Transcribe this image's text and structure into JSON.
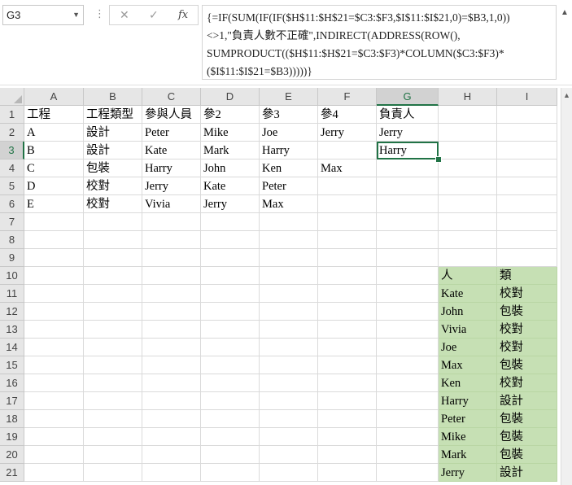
{
  "name_box": {
    "value": "G3",
    "dropdown_icon": "chevron-down-icon"
  },
  "formula_buttons": {
    "cancel": "✕",
    "enter": "✓",
    "fx": "fx"
  },
  "formula_bar": {
    "text": "{=IF(SUM(IF(IF($H$11:$H$21=$C3:$F3,$I$11:$I$21,0)=$B3,1,0))\n<>1,\"負責人數不正確\",INDIRECT(ADDRESS(ROW(),\nSUMPRODUCT(($H$11:$H$21=$C3:$F3)*COLUMN($C3:$F3)*\n($I$11:$I$21=$B3)))))}"
  },
  "columns": [
    "A",
    "B",
    "C",
    "D",
    "E",
    "F",
    "G",
    "H",
    "I"
  ],
  "rows": [
    "1",
    "2",
    "3",
    "4",
    "5",
    "6",
    "7",
    "8",
    "9",
    "10",
    "11",
    "12",
    "13",
    "14",
    "15",
    "16",
    "17",
    "18",
    "19",
    "20",
    "21"
  ],
  "selected": {
    "column": "G",
    "row": "3"
  },
  "cells": [
    [
      "工程",
      "工程類型",
      "參與人員",
      "參2",
      "參3",
      "參4",
      "負責人",
      "",
      ""
    ],
    [
      "A",
      "設計",
      "Peter",
      "Mike",
      "Joe",
      "Jerry",
      "Jerry",
      "",
      ""
    ],
    [
      "B",
      "設計",
      "Kate",
      "Mark",
      "Harry",
      "",
      "Harry",
      "",
      ""
    ],
    [
      "C",
      "包裝",
      "Harry",
      "John",
      "Ken",
      "Max",
      "",
      "",
      ""
    ],
    [
      "D",
      "校對",
      "Jerry",
      "Kate",
      "Peter",
      "",
      "",
      "",
      ""
    ],
    [
      "E",
      "校對",
      "Vivia",
      "Jerry",
      "Max",
      "",
      "",
      "",
      ""
    ],
    [
      "",
      "",
      "",
      "",
      "",
      "",
      "",
      "",
      ""
    ],
    [
      "",
      "",
      "",
      "",
      "",
      "",
      "",
      "",
      ""
    ],
    [
      "",
      "",
      "",
      "",
      "",
      "",
      "",
      "",
      ""
    ],
    [
      "",
      "",
      "",
      "",
      "",
      "",
      "",
      "人",
      "類"
    ],
    [
      "",
      "",
      "",
      "",
      "",
      "",
      "",
      "Kate",
      "校對"
    ],
    [
      "",
      "",
      "",
      "",
      "",
      "",
      "",
      "John",
      "包裝"
    ],
    [
      "",
      "",
      "",
      "",
      "",
      "",
      "",
      "Vivia",
      "校對"
    ],
    [
      "",
      "",
      "",
      "",
      "",
      "",
      "",
      "Joe",
      "校對"
    ],
    [
      "",
      "",
      "",
      "",
      "",
      "",
      "",
      "Max",
      "包裝"
    ],
    [
      "",
      "",
      "",
      "",
      "",
      "",
      "",
      "Ken",
      "校對"
    ],
    [
      "",
      "",
      "",
      "",
      "",
      "",
      "",
      "Harry",
      "設計"
    ],
    [
      "",
      "",
      "",
      "",
      "",
      "",
      "",
      "Peter",
      "包裝"
    ],
    [
      "",
      "",
      "",
      "",
      "",
      "",
      "",
      "Mike",
      "包裝"
    ],
    [
      "",
      "",
      "",
      "",
      "",
      "",
      "",
      "Mark",
      "包裝"
    ],
    [
      "",
      "",
      "",
      "",
      "",
      "",
      "",
      "Jerry",
      "設計"
    ]
  ],
  "colors": {
    "green_fill": "#c6e0b4",
    "selection": "#217346"
  }
}
